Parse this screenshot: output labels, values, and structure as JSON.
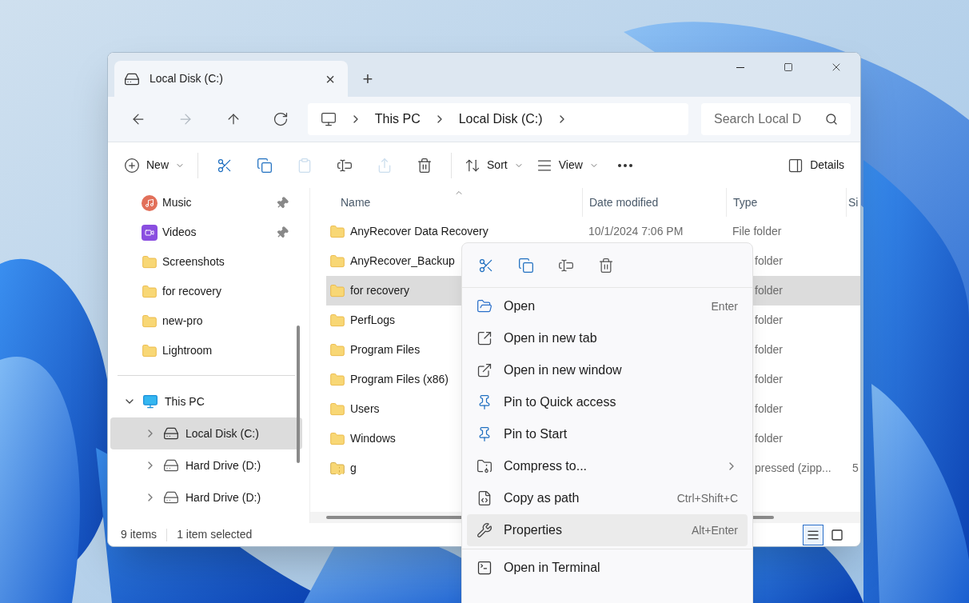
{
  "window": {
    "tab_title": "Local Disk (C:)",
    "tab_close": "×",
    "new_tab": "+"
  },
  "address": {
    "crumbs": [
      "This PC",
      "Local Disk (C:)"
    ]
  },
  "search": {
    "placeholder": "Search Local D"
  },
  "nav_buttons": [
    {
      "disabled": false
    },
    {
      "disabled": true
    },
    {
      "disabled": false
    },
    {
      "disabled": false
    }
  ],
  "toolbar": [
    {
      "kind": "menu",
      "label": "New",
      "disabled": false
    },
    {
      "kind": "icon",
      "disabled": false
    },
    {
      "kind": "icon",
      "disabled": false
    },
    {
      "kind": "icon",
      "disabled": true
    },
    {
      "kind": "icon",
      "disabled": false
    },
    {
      "kind": "icon",
      "disabled": true
    },
    {
      "kind": "icon",
      "disabled": false
    },
    {
      "kind": "menu",
      "label": "Sort",
      "disabled": false
    },
    {
      "kind": "menu",
      "label": "View",
      "disabled": false
    },
    {
      "kind": "icon",
      "disabled": false
    },
    {
      "kind": "toggle",
      "label": "Details",
      "disabled": false
    }
  ],
  "sidebar": {
    "quick": [
      {
        "label": "Music",
        "kind": "music",
        "pinned": true
      },
      {
        "label": "Videos",
        "kind": "video",
        "pinned": true
      },
      {
        "label": "Screenshots",
        "kind": "folder",
        "pinned": false
      },
      {
        "label": "for recovery",
        "kind": "folder",
        "pinned": false
      },
      {
        "label": "new-pro",
        "kind": "folder",
        "pinned": false
      },
      {
        "label": "Lightroom",
        "kind": "folder",
        "pinned": false
      }
    ],
    "tree": [
      {
        "label": "This PC",
        "kind": "pc",
        "expanded": true,
        "selected": false,
        "children": [
          {
            "label": "Local Disk (C:)",
            "kind": "system-drive",
            "expanded": false,
            "selected": true
          },
          {
            "label": "Hard Drive (D:)",
            "kind": "drive",
            "expanded": false,
            "selected": false
          },
          {
            "label": "Hard Drive (D:)",
            "kind": "drive",
            "expanded": false,
            "selected": false
          }
        ]
      }
    ]
  },
  "table": {
    "columns": [
      "Name",
      "Date modified",
      "Type",
      "Si"
    ],
    "rows": [
      {
        "name": "AnyRecover Data Recovery",
        "kind": "folder",
        "date": "10/1/2024 7:06 PM",
        "type": "File folder",
        "selected": false,
        "covered": false
      },
      {
        "name": "AnyRecover_Backup",
        "kind": "folder",
        "type": "folder",
        "selected": false,
        "covered": true
      },
      {
        "name": "for recovery",
        "kind": "folder",
        "type": "folder",
        "selected": true,
        "covered": true
      },
      {
        "name": "PerfLogs",
        "kind": "folder",
        "type": "folder",
        "selected": false,
        "covered": true
      },
      {
        "name": "Program Files",
        "kind": "folder",
        "type": "folder",
        "selected": false,
        "covered": true
      },
      {
        "name": "Program Files (x86)",
        "kind": "folder",
        "type": "folder",
        "selected": false,
        "covered": true
      },
      {
        "name": "Users",
        "kind": "folder",
        "type": "folder",
        "selected": false,
        "covered": true
      },
      {
        "name": "Windows",
        "kind": "folder",
        "type": "folder",
        "selected": false,
        "covered": true
      },
      {
        "name": "g",
        "kind": "zip",
        "type": "pressed (zipp...",
        "size": "5",
        "selected": false,
        "covered": true
      }
    ]
  },
  "status_bar": {
    "count": "9 items",
    "selection": "1 item selected",
    "views": [
      {
        "selected": true
      },
      {
        "selected": false
      }
    ]
  },
  "context_menu": {
    "actions": [
      {
        "disabled": false
      },
      {
        "disabled": false
      },
      {
        "disabled": false
      },
      {
        "disabled": false
      }
    ],
    "groups": [
      [
        {
          "label": "Open",
          "shortcut": "Enter",
          "submenu": false,
          "selected": false
        },
        {
          "label": "Open in new tab",
          "submenu": false,
          "selected": false
        },
        {
          "label": "Open in new window",
          "submenu": false,
          "selected": false
        },
        {
          "label": "Pin to Quick access",
          "submenu": false,
          "selected": false
        },
        {
          "label": "Pin to Start",
          "submenu": false,
          "selected": false
        },
        {
          "label": "Compress to...",
          "submenu": true,
          "selected": false
        },
        {
          "label": "Copy as path",
          "shortcut": "Ctrl+Shift+C",
          "submenu": false,
          "selected": false
        },
        {
          "label": "Properties",
          "shortcut": "Alt+Enter",
          "submenu": false,
          "selected": true
        }
      ],
      [
        {
          "label": "Open in Terminal",
          "submenu": false,
          "selected": false
        }
      ]
    ]
  }
}
